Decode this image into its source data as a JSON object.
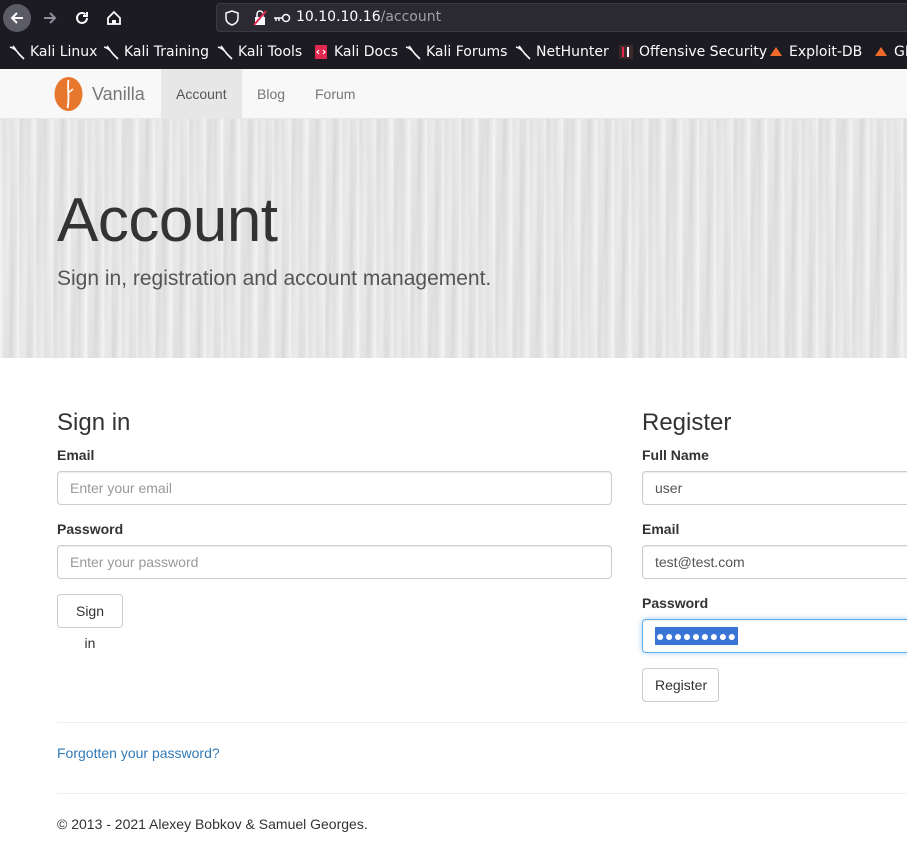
{
  "browser": {
    "url_host": "10.10.10.16",
    "url_path": "/account",
    "bookmarks": [
      {
        "label": "Kali Linux",
        "icon": "kali-dragon-icon"
      },
      {
        "label": "Kali Training",
        "icon": "kali-dragon-icon"
      },
      {
        "label": "Kali Tools",
        "icon": "kali-dragon-icon"
      },
      {
        "label": "Kali Docs",
        "icon": "kali-docs-icon"
      },
      {
        "label": "Kali Forums",
        "icon": "kali-dragon-icon"
      },
      {
        "label": "NetHunter",
        "icon": "kali-dragon-icon"
      },
      {
        "label": "Offensive Security",
        "icon": "offsec-icon"
      },
      {
        "label": "Exploit-DB",
        "icon": "exploitdb-icon"
      },
      {
        "label": "GH",
        "icon": "exploitdb-icon"
      }
    ]
  },
  "navbar": {
    "brand": "Vanilla",
    "links": [
      "Account",
      "Blog",
      "Forum"
    ],
    "active": "Account",
    "logo_color": "#e8772e"
  },
  "hero": {
    "title": "Account",
    "subtitle": "Sign in, registration and account management."
  },
  "signin": {
    "heading": "Sign in",
    "email_label": "Email",
    "email_placeholder": "Enter your email",
    "password_label": "Password",
    "password_placeholder": "Enter your password",
    "button": "Sign in"
  },
  "register": {
    "heading": "Register",
    "fullname_label": "Full Name",
    "fullname_value": "user",
    "email_label": "Email",
    "email_value": "test@test.com",
    "password_label": "Password",
    "password_value": "●●●●●●●●●",
    "button": "Register"
  },
  "forgot_link": "Forgotten your password?",
  "footer": "© 2013 - 2021 Alexey Bobkov & Samuel Georges."
}
